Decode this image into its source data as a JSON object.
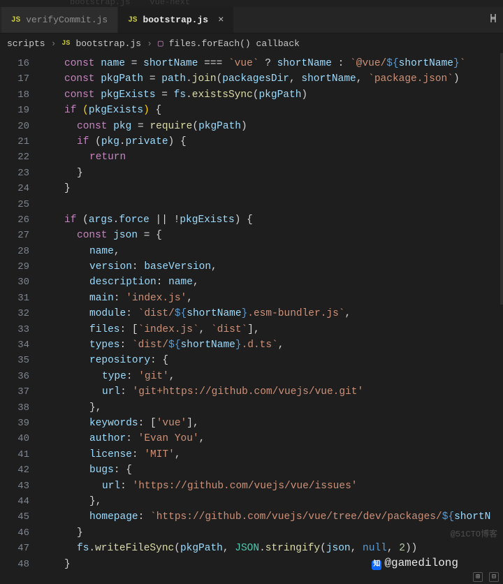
{
  "titleBar": {
    "item1": "bootstrap.js",
    "item2": "vue-next"
  },
  "tabs": {
    "items": [
      {
        "icon": "JS",
        "label": "verifyCommit.js",
        "active": false
      },
      {
        "icon": "JS",
        "label": "bootstrap.js",
        "active": true
      }
    ]
  },
  "breadcrumb": {
    "part1": "scripts",
    "icon": "JS",
    "part2": "bootstrap.js",
    "part3": "files.forEach() callback"
  },
  "lines": {
    "start": 16,
    "end": 48
  },
  "code": {
    "l16_kw": "const",
    "l16_name": "name",
    "l16_short": "shortName",
    "l16_vue": "`vue`",
    "l16_at": "`@vue/",
    "l16_sn": "shortName",
    "l16_tail": "`",
    "l17_kw": "const",
    "l17_id": "pkgPath",
    "l17_path": "path",
    "l17_join": "join",
    "l17_pd": "packagesDir",
    "l17_sn": "shortName",
    "l17_pkg": "`package.json`",
    "l18_kw": "const",
    "l18_pe": "pkgExists",
    "l18_fs": "fs",
    "l18_ex": "existsSync",
    "l18_pp": "pkgPath",
    "l19_if": "if",
    "l19_pe": "pkgExists",
    "l20_kw": "const",
    "l20_pkg": "pkg",
    "l20_req": "require",
    "l20_pp": "pkgPath",
    "l21_if": "if",
    "l21_pkg": "pkg",
    "l21_priv": "private",
    "l22_ret": "return",
    "l23_b": "}",
    "l24_b": "}",
    "l26_if": "if",
    "l26_args": "args",
    "l26_force": "force",
    "l26_pe": "pkgExists",
    "l27_kw": "const",
    "l27_json": "json",
    "l28": "name",
    "l29k": "version",
    "l29v": "baseVersion",
    "l30k": "description",
    "l30v": "name",
    "l31k": "main",
    "l31v": "'index.js'",
    "l32k": "module",
    "l32a": "`dist/",
    "l32sn": "shortName",
    "l32b": ".esm-bundler.js`",
    "l33k": "files",
    "l33a": "`index.js`",
    "l33b": "`dist`",
    "l34k": "types",
    "l34a": "`dist/",
    "l34sn": "shortName",
    "l34b": ".d.ts`",
    "l35k": "repository",
    "l36k": "type",
    "l36v": "'git'",
    "l37k": "url",
    "l37a": "'git+",
    "l37u": "https://github.com/vuejs/vue.git",
    "l37b": "'",
    "l38": "}",
    "l39k": "keywords",
    "l39v": "'vue'",
    "l40k": "author",
    "l40v": "'Evan You'",
    "l41k": "license",
    "l41v": "'MIT'",
    "l42k": "bugs",
    "l43k": "url",
    "l43a": "'",
    "l43u": "https://github.com/vuejs/vue/issues",
    "l43b": "'",
    "l44": "}",
    "l45k": "homepage",
    "l45a": "`",
    "l45u": "https://github.com/vuejs/vue/tree/dev/packages/",
    "l45sn": "shortN",
    "l46": "}",
    "l47_fs": "fs",
    "l47_fn": "writeFileSync",
    "l47_pp": "pkgPath",
    "l47_J": "JSON",
    "l47_str": "stringify",
    "l47_j": "json",
    "l47_null": "null",
    "l47_2": "2",
    "l48": "}"
  },
  "watermark": {
    "blog": "@51CTO博客",
    "zh": "知",
    "handle": "@gamedilong"
  }
}
